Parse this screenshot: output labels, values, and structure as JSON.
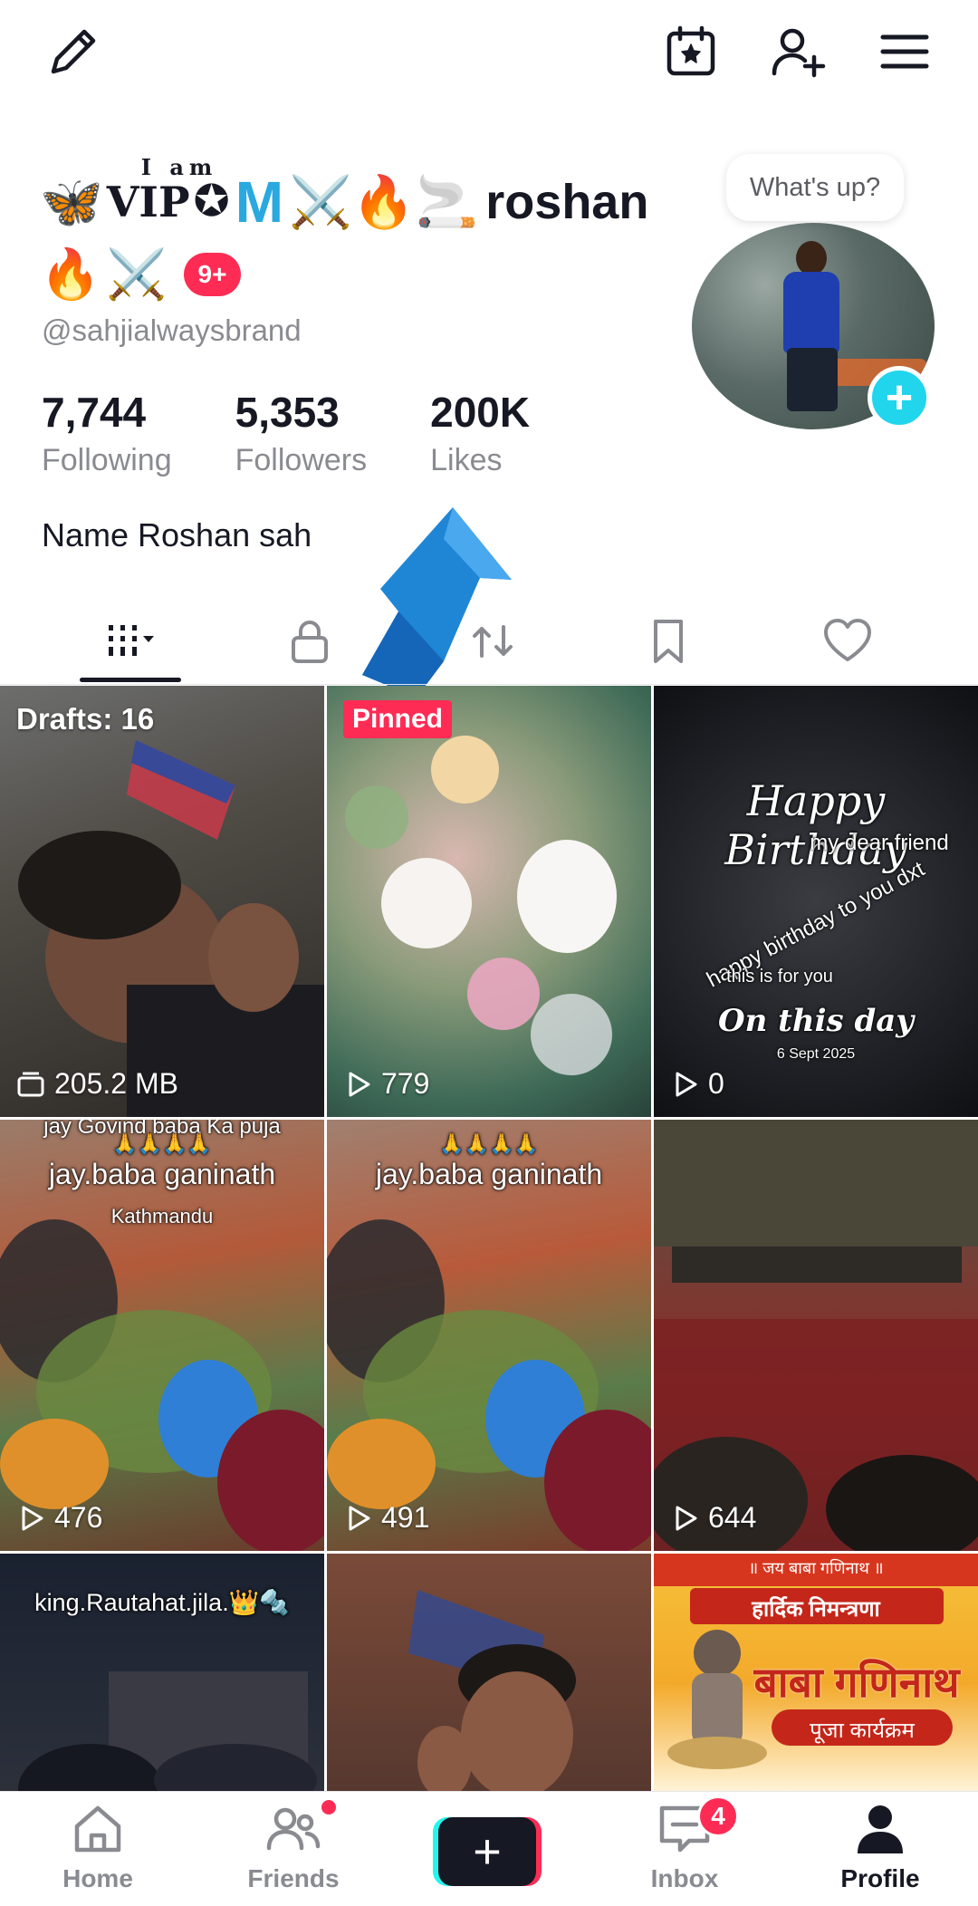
{
  "header": {
    "display_name_parts": {
      "butterfly": "🦋",
      "vip_sup": "I am",
      "vip": "VIP",
      "star": "✪",
      "m": "M",
      "swords": "⚔️",
      "fire": "🔥",
      "cigarette": "🚬",
      "name": "roshan"
    },
    "display_name_line2": {
      "fire": "🔥",
      "swords": "⚔️"
    },
    "notification_badge": "9+",
    "handle": "@sahjialwaysbrand",
    "whats_up": "What's up?",
    "stats": [
      {
        "value": "7,744",
        "label": "Following"
      },
      {
        "value": "5,353",
        "label": "Followers"
      },
      {
        "value": "200K",
        "label": "Likes"
      }
    ],
    "bio": "Name Roshan sah"
  },
  "grid": {
    "c1": {
      "top": "Drafts: 16",
      "meta": "205.2 MB"
    },
    "c2": {
      "pinned": "Pinned",
      "meta": "779"
    },
    "c3": {
      "line1": "Happy Birthday",
      "line2": "my dear friend",
      "line3": "happy birthday to you dxt",
      "line4": "this is for you",
      "line5": "On this day",
      "line6": "6 Sept 2025",
      "meta": "0"
    },
    "c4": {
      "line1": "jay Govind baba Ka puja",
      "line2": "🙏🙏🙏🙏",
      "line3": "jay.baba ganinath",
      "line4": "Kathmandu",
      "meta": "476"
    },
    "c5": {
      "line2": "🙏🙏🙏🙏",
      "line3": "jay.baba ganinath",
      "meta": "491"
    },
    "c6": {
      "meta": "644"
    },
    "c7": {
      "line1": "king.Rautahat.jila.👑🔩"
    },
    "c9": {
      "line1": "॥ जय बाबा गणिनाथ ॥",
      "line2": "हार्दिक निमन्त्रणा",
      "line3": "बाबा गणिनाथ",
      "line4": "पूजा कार्यक्रम"
    }
  },
  "nav": {
    "home": "Home",
    "friends": "Friends",
    "inbox": "Inbox",
    "inbox_badge": "4",
    "profile": "Profile"
  },
  "colors": {
    "accent_red": "#fe2c55",
    "accent_cyan": "#20d5ec",
    "text_primary": "#161823",
    "text_secondary": "#8a8b91"
  }
}
